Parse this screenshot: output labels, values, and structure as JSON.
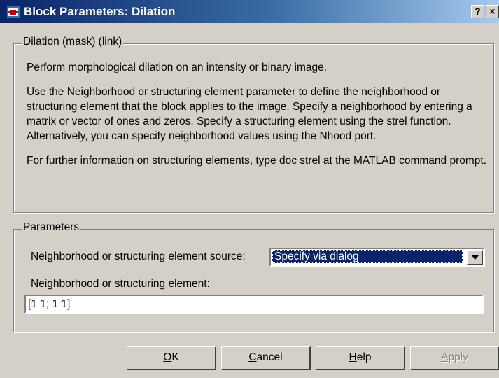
{
  "window": {
    "title": "Block Parameters: Dilation",
    "help_glyph": "?",
    "close_glyph": "×"
  },
  "description_group": {
    "label": "Dilation (mask) (link)",
    "paragraphs": [
      "Perform morphological dilation on an intensity or binary image.",
      "Use the Neighborhood or structuring element parameter to define the neighborhood or structuring element that the block applies to the image.  Specify a neighborhood by entering a matrix or vector of ones and zeros.  Specify a structuring element using the strel function.  Alternatively, you can specify neighborhood values using the Nhood port.",
      "For further information on structuring elements, type doc strel at the MATLAB command prompt."
    ]
  },
  "parameters_group": {
    "label": "Parameters",
    "source_label": "Neighborhood or structuring element source:",
    "source_value": "Specify via dialog",
    "element_label": "Neighborhood or structuring element:",
    "element_value": "[1 1; 1 1]"
  },
  "buttons": {
    "ok": {
      "mnemonic": "O",
      "rest": "K"
    },
    "cancel": {
      "mnemonic": "C",
      "rest": "ancel"
    },
    "help": {
      "mnemonic": "H",
      "rest": "elp"
    },
    "apply": {
      "mnemonic": "A",
      "rest": "pply"
    }
  },
  "colors": {
    "titlebar_start": "#0a246a",
    "titlebar_end": "#a6caf0",
    "dialog_background": "#d4d0c8",
    "selection": "#0a246a"
  },
  "icons": {
    "app": "simulink-block-icon",
    "dropdown": "chevron-down-icon"
  }
}
